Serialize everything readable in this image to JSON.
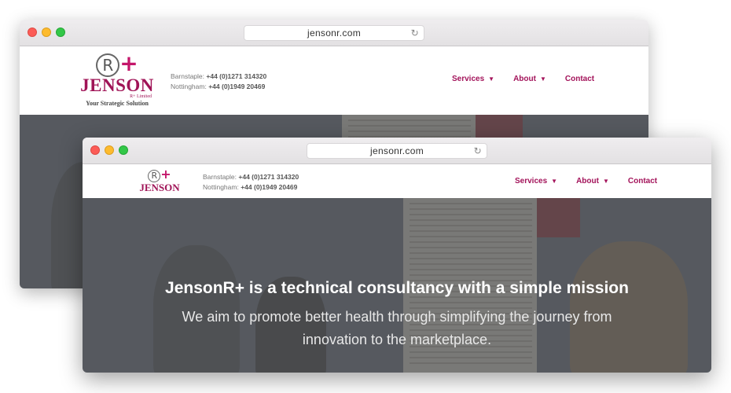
{
  "windows": [
    {
      "url": "jensonr.com",
      "logo": {
        "mark": "R",
        "plus": "+",
        "name": "JENSON",
        "sub": "R+ Limited",
        "tagline": "Your Strategic Solution"
      },
      "phones": [
        {
          "label": "Barnstaple:",
          "number": "+44 (0)1271 314320"
        },
        {
          "label": "Nottingham:",
          "number": "+44 (0)1949 20469"
        }
      ],
      "nav": [
        {
          "label": "Services",
          "icon": "chevron-down-icon"
        },
        {
          "label": "About",
          "icon": "chevron-down-icon"
        },
        {
          "label": "Contact"
        }
      ]
    },
    {
      "url": "jensonr.com",
      "logo": {
        "mark": "R",
        "plus": "+",
        "name": "JENSON"
      },
      "phones": [
        {
          "label": "Barnstaple:",
          "number": "+44 (0)1271 314320"
        },
        {
          "label": "Nottingham:",
          "number": "+44 (0)1949 20469"
        }
      ],
      "nav": [
        {
          "label": "Services",
          "icon": "chevron-down-icon"
        },
        {
          "label": "About",
          "icon": "chevron-down-icon"
        },
        {
          "label": "Contact"
        }
      ],
      "hero": {
        "title": "JensonR+ is a technical consultancy with a simple mission",
        "subtitle": "We aim to promote better health through simplifying the journey from innovation to the marketplace."
      }
    }
  ],
  "colors": {
    "brand": "#a3135a",
    "overlay": "#464a52"
  }
}
